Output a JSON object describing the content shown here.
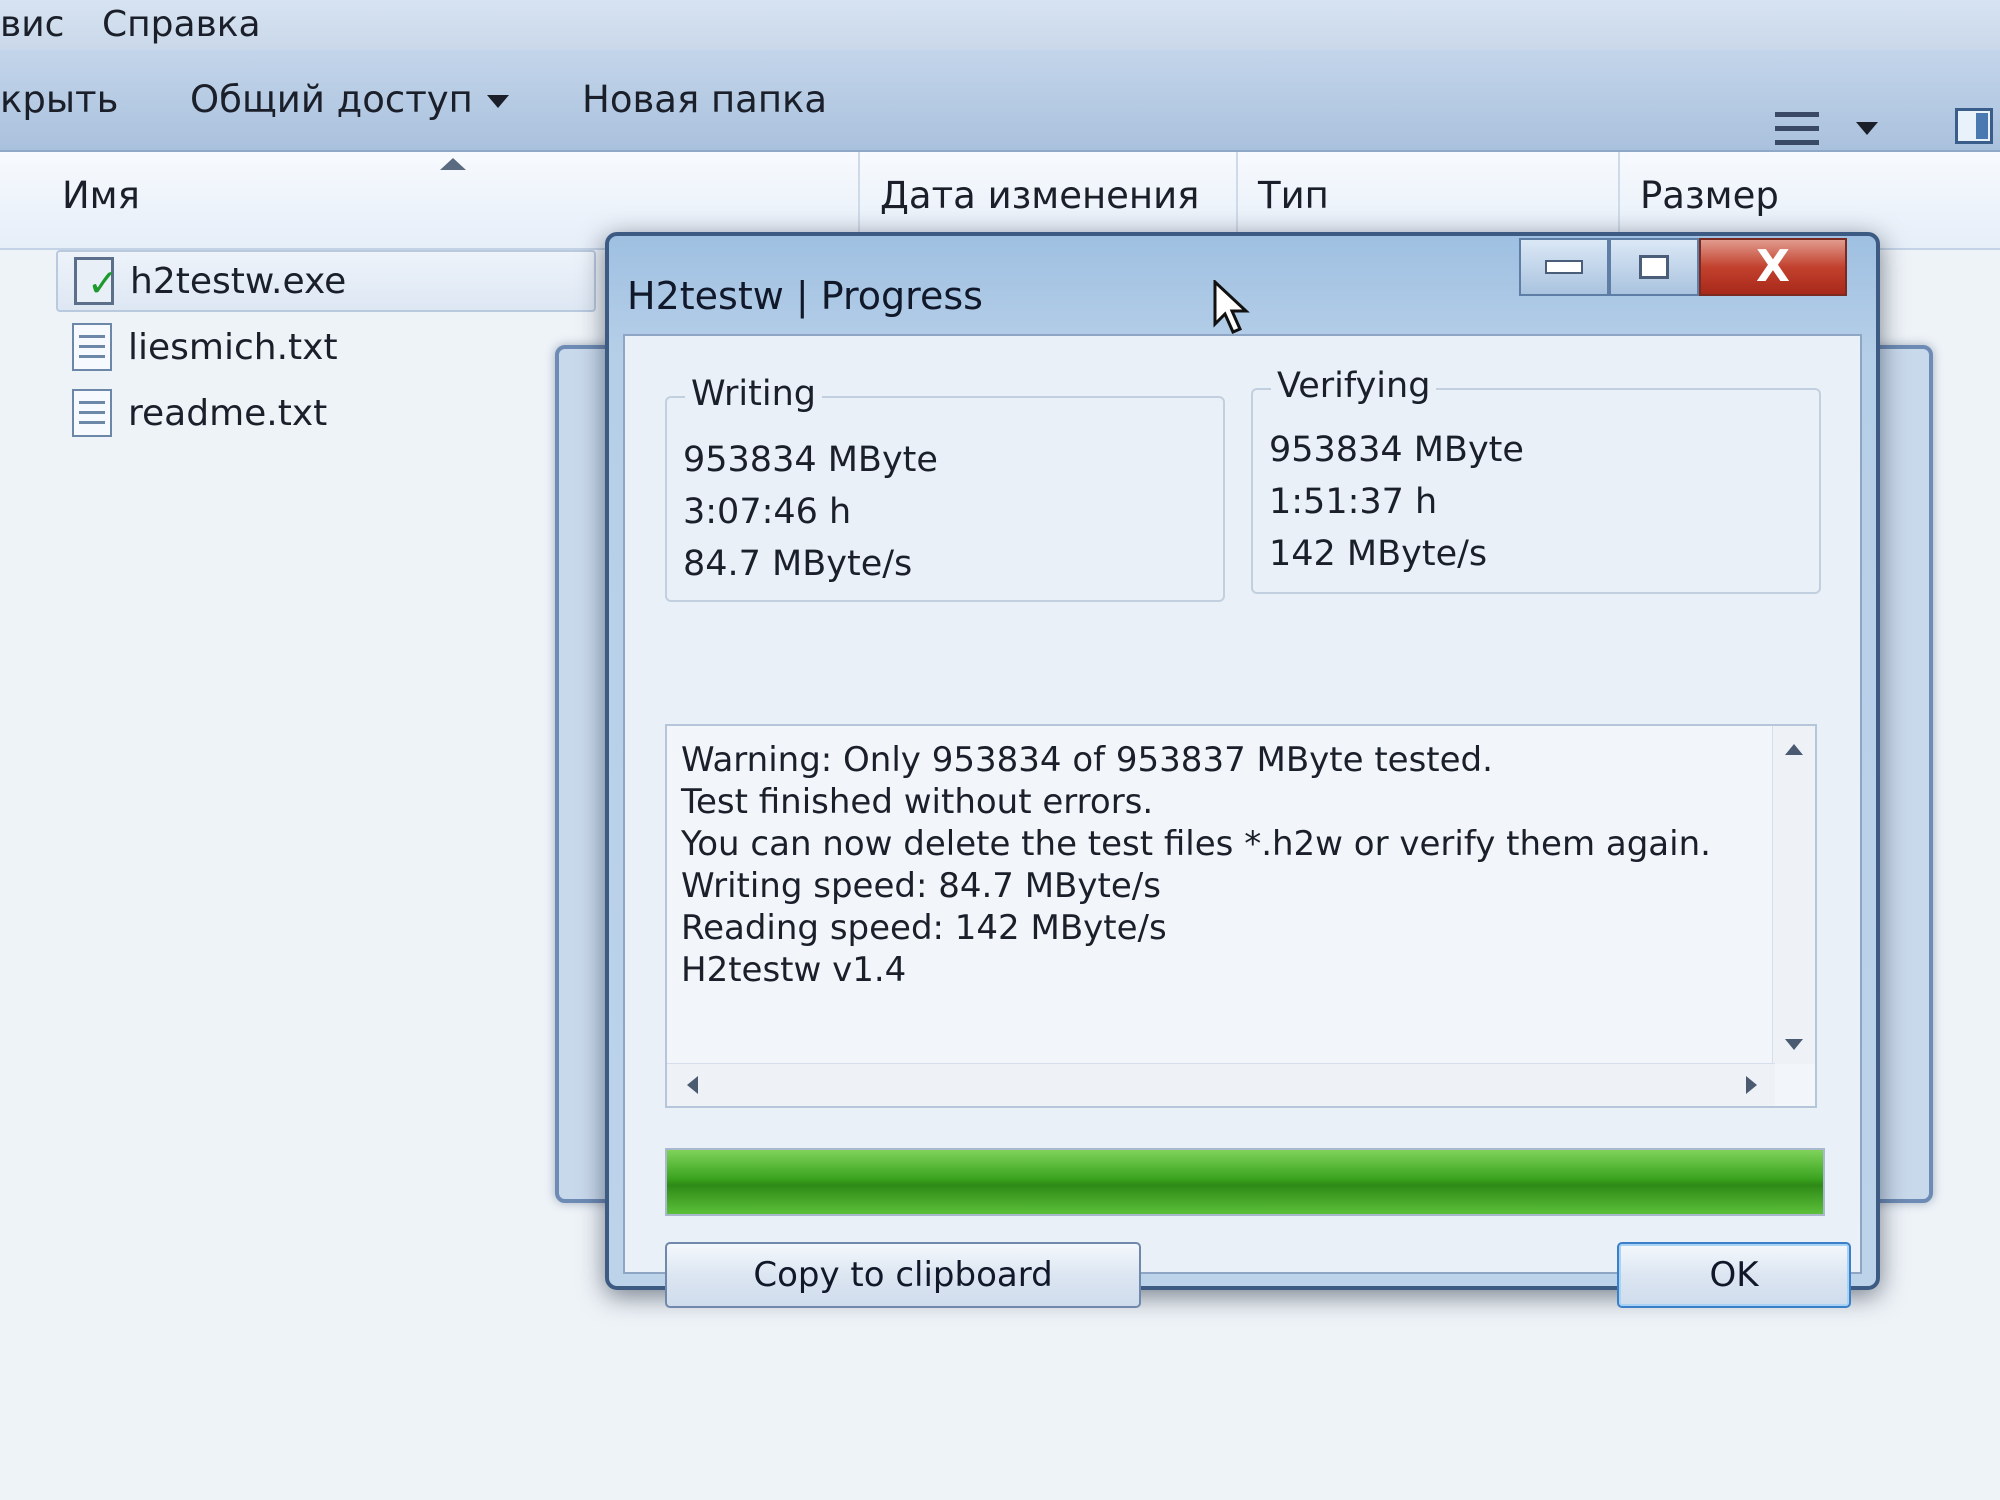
{
  "menubar": {
    "items": [
      "вис",
      "Справка"
    ]
  },
  "toolbar": {
    "open": "крыть",
    "share": "Общий доступ",
    "new_folder": "Новая папка"
  },
  "columns": {
    "name": "Имя",
    "date": "Дата изменения",
    "type": "Тип",
    "size": "Размер"
  },
  "files": [
    {
      "name": "h2testw.exe",
      "icon": "exe-checkmark-icon",
      "selected": true
    },
    {
      "name": "liesmich.txt",
      "icon": "text-file-icon"
    },
    {
      "name": "readme.txt",
      "icon": "text-file-icon"
    }
  ],
  "dialog": {
    "title": "H2testw | Progress",
    "writing": {
      "label": "Writing",
      "size": "953834 MByte",
      "time": "3:07:46 h",
      "speed": "84.7 MByte/s"
    },
    "verifying": {
      "label": "Verifying",
      "size": "953834 MByte",
      "time": "1:51:37 h",
      "speed": "142 MByte/s"
    },
    "log": [
      "Warning: Only 953834 of 953837 MByte tested.",
      "Test finished without errors.",
      "You can now delete the test files *.h2w or verify them again.",
      "Writing speed: 84.7 MByte/s",
      "Reading speed: 142 MByte/s",
      "H2testw v1.4"
    ],
    "progress_fraction": 1.0,
    "copy_button": "Copy to clipboard",
    "ok_button": "OK",
    "close_glyph": "X"
  },
  "colors": {
    "progress": "#3aa31e",
    "close_button": "#c2412e"
  }
}
